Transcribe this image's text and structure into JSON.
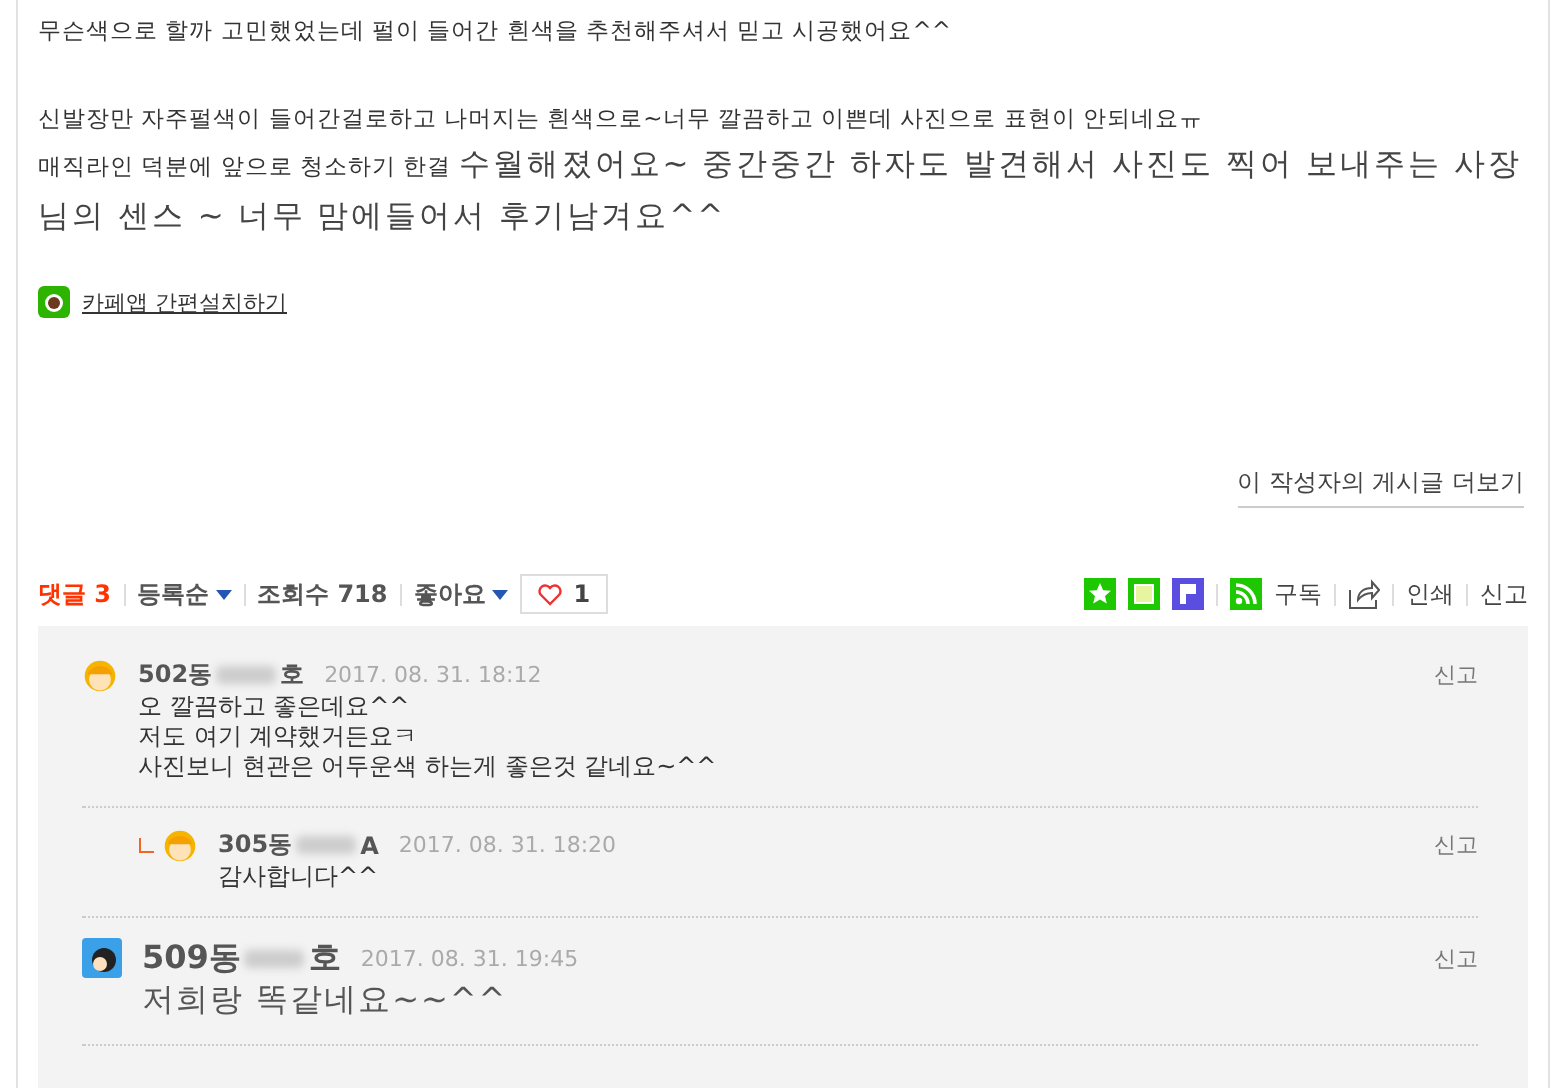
{
  "post": {
    "paragraphs": [
      [
        {
          "kind": "normal",
          "text": "무슨색으로 할까 고민했었는데  펄이 들어간 흰색을 추천해주셔서 믿고 시공했어요^^"
        }
      ],
      [
        {
          "kind": "normal",
          "text": "신발장만 자주펄색이 들어간걸로하고 나머지는 흰색으로~너무 깔끔하고 이쁜데 사진으로 표현이 안되네요ㅠ"
        }
      ],
      [
        {
          "kind": "normal",
          "text": "매직라인 덕분에 앞으로 청소하기 한결 "
        },
        {
          "kind": "large",
          "text": "수월해졌어요~ 중간중간 하자도 발견해서 사진도 찍어 보내주는 사장님의 센스 ~ 너무 맘에들어서 후기남겨요^^"
        }
      ]
    ],
    "app_link": "카페앱 간편설치하기",
    "more_posts": "이 작성자의 게시글 더보기"
  },
  "toolbar": {
    "comments_label": "댓글",
    "comments_count": "3",
    "sort": "등록순",
    "views": "조회수 718",
    "like_label": "좋아요",
    "like_count": "1",
    "subscribe": "구독",
    "print": "인쇄",
    "report": "신고"
  },
  "comments": [
    {
      "kind": "normal",
      "author": "502동",
      "author_suffix": "호",
      "date": "2017. 08. 31.  18:12",
      "lines": [
        "오 깔끔하고 좋은데요^^",
        "저도 여기 계약했거든요ㅋ",
        "사진보니 현관은 어두운색 하는게 좋은것 같네요~^^"
      ],
      "report": "신고"
    },
    {
      "kind": "reply",
      "author": "305동",
      "author_suffix": "A",
      "date": "2017. 08. 31.  18:20",
      "lines": [
        "감사합니다^^"
      ],
      "report": "신고"
    },
    {
      "kind": "large",
      "author": "509동",
      "author_suffix": "호",
      "date": "2017. 08. 31.  19:45",
      "lines": [
        "저희랑 똑같네요~~^^"
      ],
      "report": "신고"
    }
  ]
}
